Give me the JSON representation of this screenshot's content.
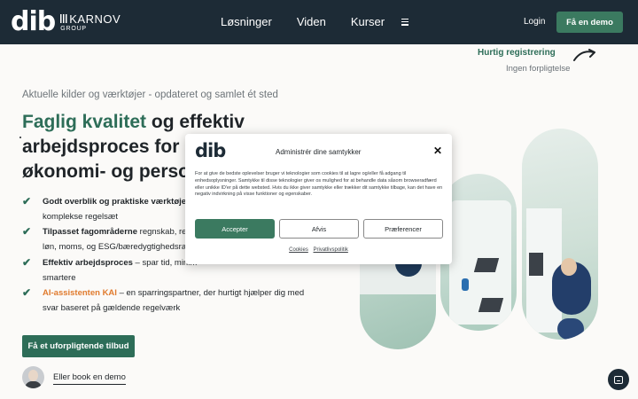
{
  "header": {
    "logo": {
      "dib": "dib",
      "karnov": "KARNOV",
      "group": "GROUP"
    },
    "nav": [
      "Løsninger",
      "Viden",
      "Kurser"
    ],
    "login_label": "Login",
    "demo_label": "Få en demo"
  },
  "hurtig": {
    "title": "Hurtig registrering",
    "subtitle": "Ingen forpligtelse"
  },
  "hero": {
    "subtitle": "Aktuelle kilder og værktøjer - opdateret og samlet ét sted",
    "headline_accent": "Faglig kvalitet",
    "headline_rest_1": " og effektiv",
    "headline_line2": "arbejdsproces for revi",
    "headline_line3": "økonomi- og persona"
  },
  "features": [
    {
      "bold": "Godt overblik og praktiske værktøjer",
      "text": " – g",
      "line2": "komplekse regelsæt"
    },
    {
      "bold": "Tilpasset fagområderne",
      "text": " regnskab, revis",
      "line2": "løn, moms, og ESG/bæredygtighedsrapp"
    },
    {
      "bold": "Effektiv arbejdsproces",
      "text": " – spar tid, minim",
      "line2": "smartere"
    },
    {
      "bold": "AI-assistenten KAI",
      "text": " – en sparringspartner, der hurtigt hjælper dig med",
      "line2": "svar baseret på gældende regelværk"
    }
  ],
  "cta": {
    "offer_label": "Få et uforpligtende tilbud",
    "book_label": "Eller book en demo"
  },
  "cookie": {
    "logo": "dib",
    "title": "Administrér dine samtykker",
    "text": "For at give de bedste oplevelser bruger vi teknologier som cookies til at lagre og/eller få adgang til enhedsoplysninger. Samtykke til disse teknologier giver os mulighed for at behandle data såsom browseradfærd eller unikke ID'er på dette websted. Hvis du ikke giver samtykke eller trækker dit samtykke tilbage, kan det have en negativ indvirkning på visse funktioner og egenskaber.",
    "accept_label": "Accepter",
    "deny_label": "Afvis",
    "prefs_label": "Præferencer",
    "cookies_link": "Cookies",
    "privacy_link": "Privatlivspolitik"
  },
  "colors": {
    "brand_dark": "#1d2b36",
    "brand_green": "#2d6d58",
    "accent_orange": "#e07b2e"
  }
}
